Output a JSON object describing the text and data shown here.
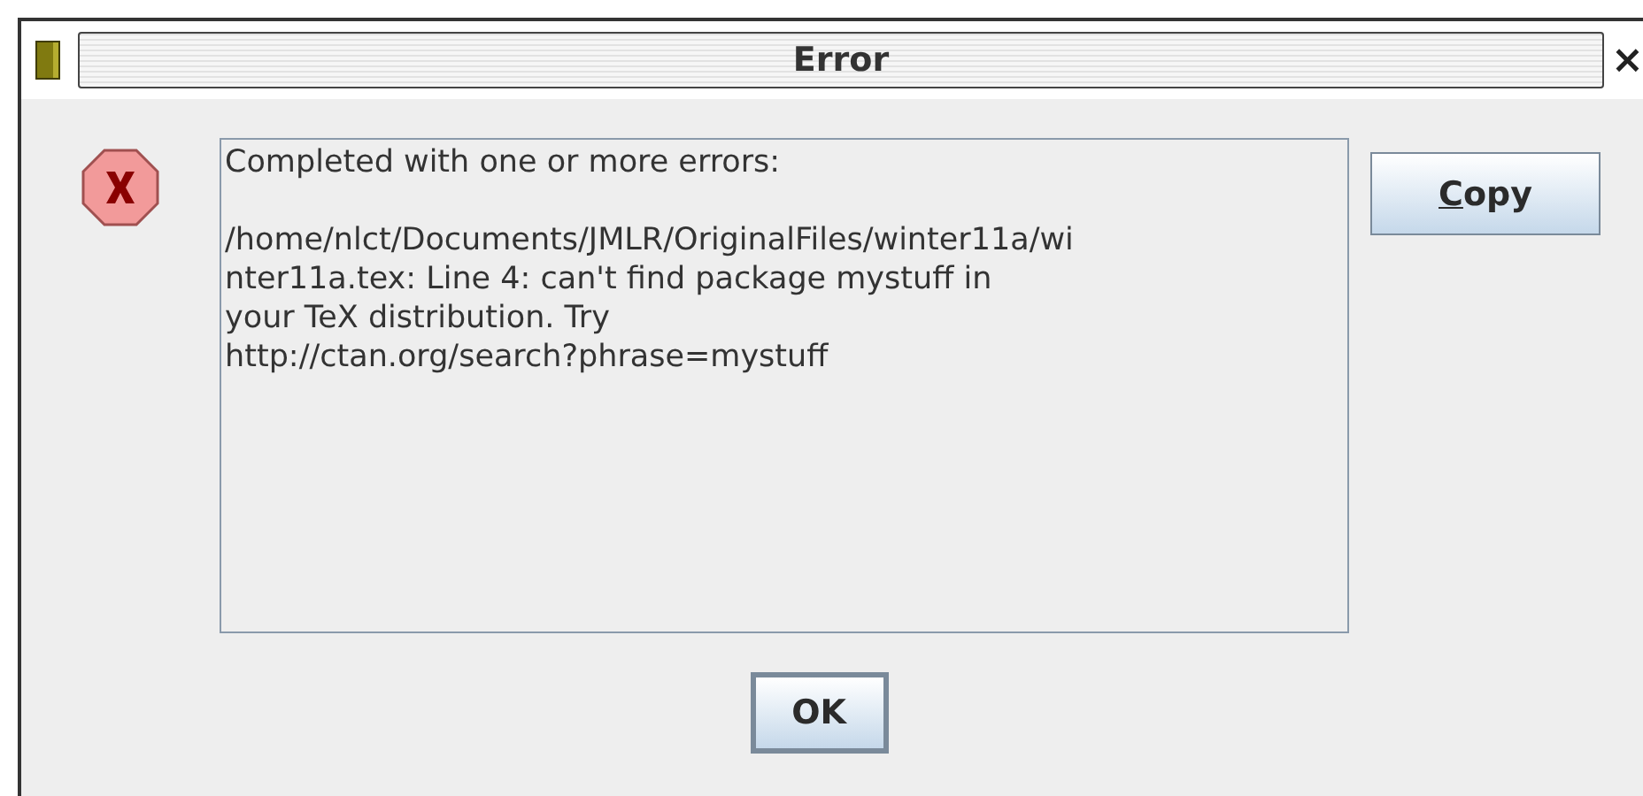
{
  "window": {
    "title": "Error",
    "close": "×"
  },
  "message": {
    "paragraphs": [
      [
        "Completed with one or more errors:"
      ],
      [
        "/home/nlct/Documents/JMLR/OriginalFiles/winter11a/wi",
        "nter11a.tex: Line 4: can't find package mystuff in",
        "your TeX distribution. Try",
        "http://ctan.org/search?phrase=mystuff"
      ]
    ]
  },
  "buttons": [
    {
      "kind": "side",
      "label": "Copy",
      "mnemonic_underlined": true
    },
    {
      "kind": "footer",
      "label": "OK",
      "mnemonic_underlined": false
    }
  ]
}
